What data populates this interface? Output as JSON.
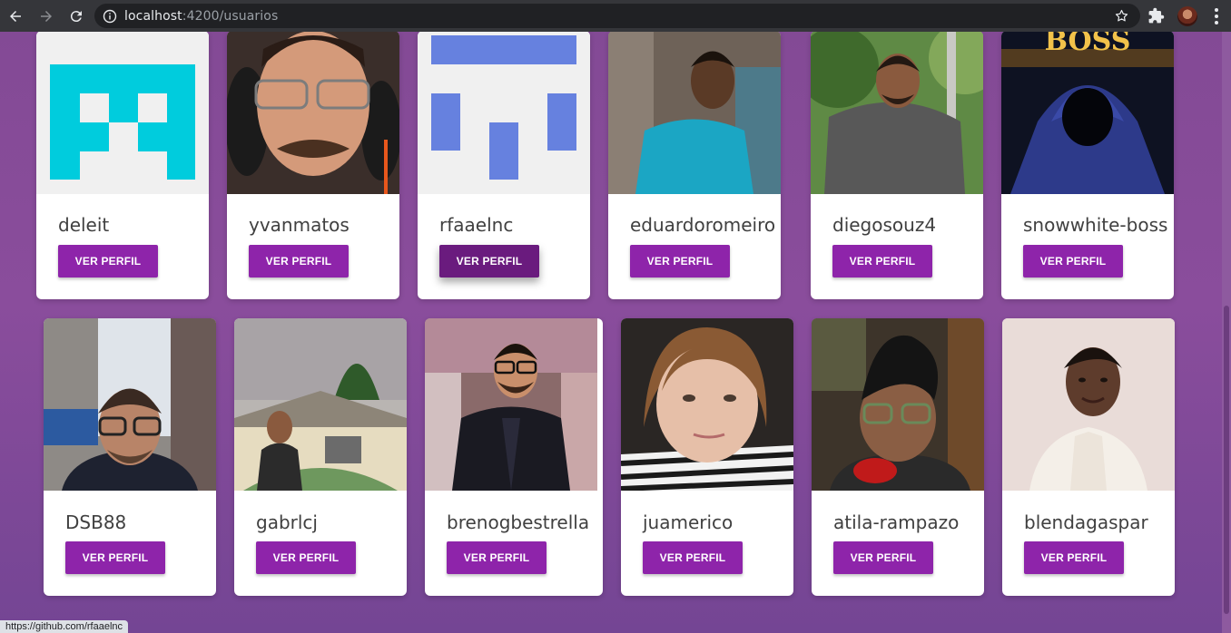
{
  "browser": {
    "url_host": "localhost",
    "url_rest": ":4200/usuarios",
    "status_url": "https://github.com/rfaaelnc"
  },
  "colors": {
    "button": "#8e24aa",
    "button_hover": "#6a1b7e",
    "page_bg": "#834a95"
  },
  "button_label": "VER PERFIL",
  "users": [
    {
      "login": "deleit",
      "avatar": "identicon-cyan"
    },
    {
      "login": "yvanmatos",
      "avatar": "photo"
    },
    {
      "login": "rfaaelnc",
      "avatar": "identicon-blue"
    },
    {
      "login": "eduardoromeiro",
      "avatar": "photo"
    },
    {
      "login": "diegosouz4",
      "avatar": "photo"
    },
    {
      "login": "snowwhite-boss",
      "avatar": "boss-hoodie",
      "avatar_text": "BOSS"
    },
    {
      "login": "DSB88",
      "avatar": "photo"
    },
    {
      "login": "gabrlcj",
      "avatar": "photo"
    },
    {
      "login": "brenogbestrella",
      "avatar": "photo"
    },
    {
      "login": "juamerico",
      "avatar": "photo"
    },
    {
      "login": "atila-rampazo",
      "avatar": "photo"
    },
    {
      "login": "blendagaspar",
      "avatar": "photo"
    }
  ]
}
